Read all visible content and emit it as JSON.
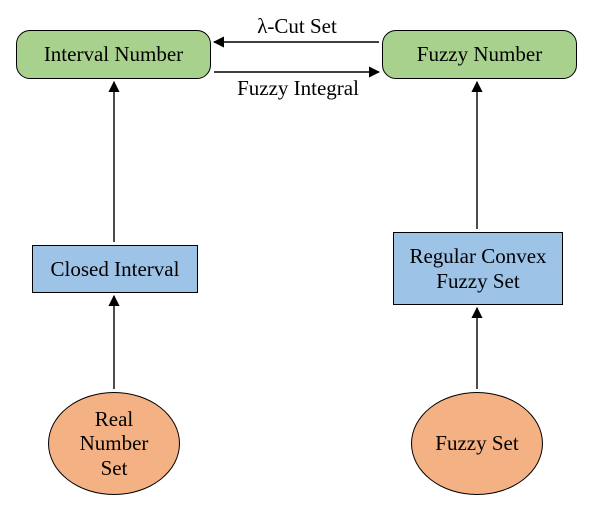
{
  "nodes": {
    "interval_number": "Interval Number",
    "fuzzy_number": "Fuzzy Number",
    "closed_interval": "Closed Interval",
    "regular_convex_fuzzy_set": "Regular Convex\nFuzzy Set",
    "real_number_set": "Real\nNumber\nSet",
    "fuzzy_set": "Fuzzy Set"
  },
  "edges": {
    "lambda_cut_set": "λ-Cut Set",
    "fuzzy_integral": "Fuzzy Integral"
  }
}
